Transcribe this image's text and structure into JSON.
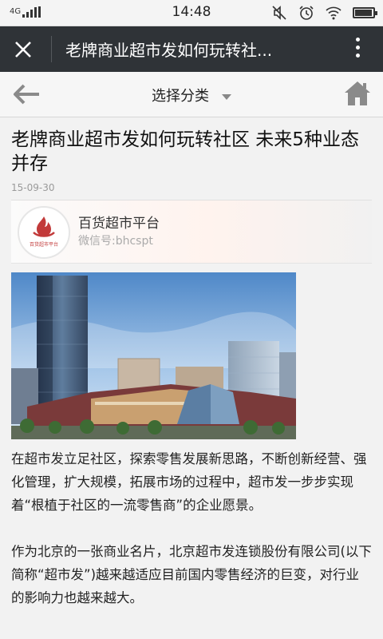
{
  "status_bar": {
    "network": "4G",
    "time": "14:48",
    "icons": [
      "signal-icon",
      "mute-icon",
      "alarm-icon",
      "wifi-icon",
      "battery-icon"
    ],
    "battery_level": 0.95
  },
  "app_bar": {
    "title": "老牌商业超市发如何玩转社...",
    "icons": [
      "close-icon",
      "more-icon"
    ]
  },
  "category_bar": {
    "label": "选择分类",
    "icons": [
      "back-arrow-icon",
      "chevron-down-icon",
      "home-icon"
    ]
  },
  "article": {
    "title": "老牌商业超市发如何玩转社区 未来5种业态并存",
    "date": "15-09-30",
    "source": {
      "name": "百货超市平台",
      "wechat_id": "微信号:bhcspt",
      "logo_text": "百货超市平台"
    },
    "image_alt_icon": "city-building-photo",
    "paragraphs": [
      "在超市发立足社区，探索零售发展新思路，不断创新经营、强化管理，扩大规模，拓展市场的过程中，超市发一步步实现着“根植于社区的一流零售商”的企业愿景。",
      "作为北京的一张商业名片，北京超市发连锁股份有限公司(以下简称“超市发”)越来越适应目前国内零售经济的巨变，对行业的影响力也越来越大。"
    ]
  },
  "colors": {
    "app_bar_bg": "#2f3337",
    "background": "#f2f2f2",
    "logo_red": "#c23a3a"
  }
}
